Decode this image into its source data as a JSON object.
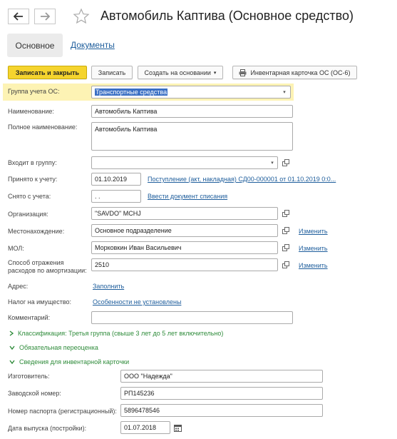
{
  "window": {
    "title": "Автомобиль Каптива (Основное средство)"
  },
  "tabs": [
    {
      "label": "Основное"
    },
    {
      "label": "Документы"
    }
  ],
  "toolbar": {
    "save_close_label": "Записать и закрыть",
    "save_label": "Записать",
    "create_based_label": "Создать на основании",
    "print_label": "Инвентарная карточка ОС (ОС-6)"
  },
  "form": {
    "group_label": "Группа учета ОС:",
    "group_value": "Транспортные средства",
    "name_label": "Наименование:",
    "name_value": "Автомобиль Каптива",
    "fullname_label": "Полное наименование:",
    "fullname_value": "Автомобиль Каптива",
    "parent_label": "Входит в группу:",
    "parent_value": "",
    "accepted_label": "Принято к учету:",
    "accepted_date": "01.10.2019",
    "accepted_doc": "Поступление (акт, накладная) СД00-000001 от 01.10.2019 0:0...",
    "removed_label": "Снято с учета:",
    "removed_date": " .  .",
    "removed_link": "Ввести документ списания",
    "org_label": "Организация:",
    "org_value": "\"SAVDO\" MCHJ",
    "location_label": "Местонахождение:",
    "location_value": "Основное подразделение",
    "mol_label": "МОЛ:",
    "mol_value": "Морковкин Иван Васильевич",
    "amort_label_1": "Способ отражения",
    "amort_label_2": "расходов по амортизации:",
    "amort_value": "2510",
    "change_link": "Изменить",
    "address_label": "Адрес:",
    "address_link": "Заполнить",
    "tax_label": "Налог на имущество:",
    "tax_link": "Особенности не установлены",
    "comment_label": "Комментарий:",
    "comment_value": ""
  },
  "sections": {
    "classification": "Классификация: Третья группа (свыше 3 лет до 5 лет включительно)",
    "revaluation": "Обязательная переоценка",
    "card_info": "Сведения для инвентарной карточки"
  },
  "card": {
    "maker_label": "Изготовитель:",
    "maker_value": "ООО \"Надежда\"",
    "serial_label": "Заводской номер:",
    "serial_value": "РП145236",
    "passport_label": "Номер паспорта (регистрационный):",
    "passport_value": "5896478546",
    "year_label": "Дата выпуска (постройки):",
    "year_value": "01.07.2018"
  },
  "colors": {
    "primary_button": "#f5d42e",
    "link": "#1f5e9c",
    "section_green": "#2e8b3a",
    "highlight_row": "#fdf3b4"
  }
}
